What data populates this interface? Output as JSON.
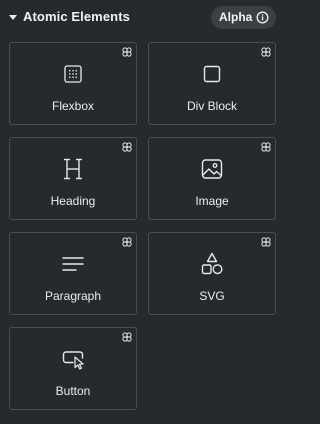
{
  "section": {
    "title": "Atomic Elements",
    "badge_label": "Alpha"
  },
  "colors": {
    "background": "#26292d",
    "tile_border": "#4a4d53",
    "text": "#eceef0",
    "badge_bg": "#3c3f45"
  },
  "tiles": [
    {
      "label": "Flexbox",
      "icon": "flexbox-icon"
    },
    {
      "label": "Div Block",
      "icon": "div-block-icon"
    },
    {
      "label": "Heading",
      "icon": "heading-icon"
    },
    {
      "label": "Image",
      "icon": "image-icon"
    },
    {
      "label": "Paragraph",
      "icon": "paragraph-icon"
    },
    {
      "label": "SVG",
      "icon": "svg-icon"
    },
    {
      "label": "Button",
      "icon": "button-icon"
    }
  ]
}
